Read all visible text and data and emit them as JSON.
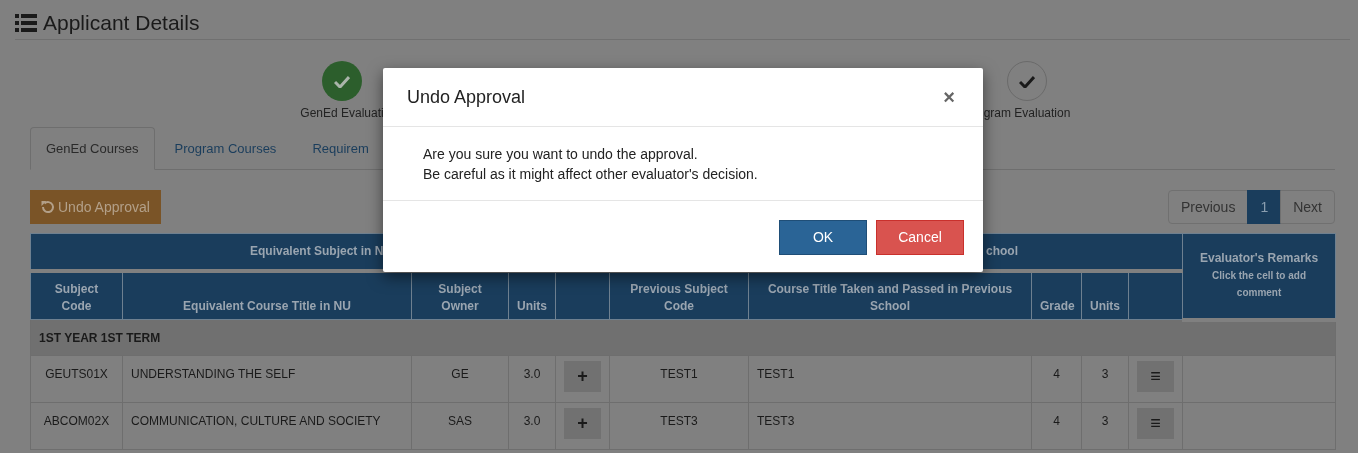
{
  "page_title": "Applicant Details",
  "steps": [
    {
      "label": "GenEd Evaluati",
      "done": true
    },
    {
      "label": "gram Evaluation",
      "done": false
    }
  ],
  "tabs": [
    {
      "label": "GenEd Courses",
      "selected": true
    },
    {
      "label": "Program Courses",
      "selected": false
    },
    {
      "label": "Requirem",
      "selected": false
    }
  ],
  "undo_button": "Undo Approval",
  "pagination": [
    {
      "label": "Previous",
      "selected": false
    },
    {
      "label": "1",
      "selected": true
    },
    {
      "label": "Next",
      "selected": false
    }
  ],
  "table": {
    "group_headers": [
      "Equivalent Subject in N",
      "chool"
    ],
    "remarks_header": {
      "title": "Evaluator's Remarks",
      "hint": "Click the cell to add comment"
    },
    "columns": [
      {
        "kind": "text",
        "label": "Subject Code"
      },
      {
        "kind": "text",
        "label": "Equivalent Course Title in NU"
      },
      {
        "kind": "text",
        "label": "Subject Owner"
      },
      {
        "kind": "text",
        "label": "Units"
      },
      {
        "kind": "button"
      },
      {
        "kind": "text",
        "label": "Previous Subject Code"
      },
      {
        "kind": "text",
        "label": "Course Title Taken and Passed in Previous School"
      },
      {
        "kind": "text",
        "label": "Grade"
      },
      {
        "kind": "text",
        "label": "Units"
      },
      {
        "kind": "button"
      }
    ],
    "sections": [
      {
        "title": "1ST YEAR 1ST TERM",
        "rows": [
          {
            "cells": [
              "GEUTS01X",
              "UNDERSTANDING THE SELF",
              "GE",
              "3.0",
              "+",
              "TEST1",
              "TEST1",
              "4",
              "3",
              "≡"
            ]
          },
          {
            "cells": [
              "ABCOM02X",
              "COMMUNICATION, CULTURE AND SOCIETY",
              "SAS",
              "3.0",
              "+",
              "TEST3",
              "TEST3",
              "4",
              "3",
              "≡"
            ]
          }
        ]
      }
    ]
  },
  "modal": {
    "title": "Undo Approval",
    "close": "×",
    "message": [
      "Are you sure you want to undo the approval.",
      "Be careful as it might affect other evaluator's decision."
    ],
    "buttons": [
      {
        "label": "OK",
        "kind": "primary"
      },
      {
        "label": "Cancel",
        "kind": "danger"
      }
    ]
  }
}
